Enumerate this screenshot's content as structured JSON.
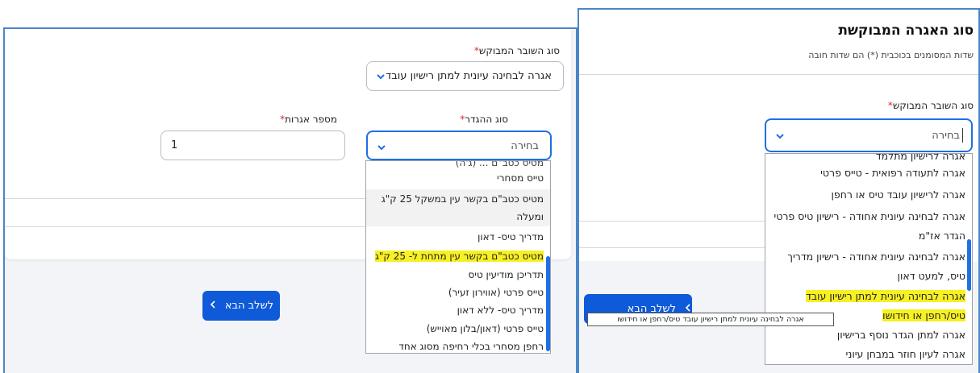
{
  "left": {
    "voucher_label": "סוג השובר המבוקש",
    "voucher_value": "אגרה לבחינה עיונית למתן רישיון עובד",
    "definition_label": "סוג ההגדר",
    "definition_value": "בחירה",
    "count_label": "מספר אגרות",
    "count_value": "1",
    "required_mark": "*",
    "partial_top_option": "מטיס כטב\"ם ... (ג'ה)",
    "options": [
      "טייס מסחרי",
      "מטיס כטב\"ם בקשר עין במשקל 25 ק\"ג ומעלה",
      "מדריך טיס- דאון",
      "מטיס כטב\"ם בקשר עין מתחת ל- 25 ק\"ג",
      "תדריכן מודיעין טיס",
      "טייס פרטי (אווירון זעיר)",
      "מדריך טיס- ללא דאון",
      "טייס פרטי (דאון/בלון מאוייש)",
      "רחפן מסחרי בכלי רחיפה מסוג אחד"
    ],
    "next_button": "לשלב הבא"
  },
  "right": {
    "title": "סוג האגרה המבוקשת",
    "subtitle": "שדות המסומנים בכוכבית (*) הם שדות חובה",
    "voucher_label": "סוג השובר המבוקש",
    "voucher_value": "בחירה",
    "required_mark": "*",
    "partial_top_option": "אגרה לרישיון מתלמד",
    "options": [
      "אגרה לתעודה רפואית - טייס פרטי",
      "אגרה לרישיון עובד טיס או רחפן",
      "אגרה לבחינה עיונית אחודה - רישיון טיס פרטי הגדר אז\"מ",
      "אגרה לבחינה עיונית אחודה - רישיון מדריך טיס, למעט דאון",
      "אגרה לבחינה עיונית למתן רישיון עובד טיס/רחפן או חידושו",
      "אגרה למתן הגדר נוסף ברישיון",
      "אגרה לעיון חוזר במבחן עיוני"
    ],
    "next_button": "לשלב הבא",
    "tooltip": "אגרה לבחינה עיונית למתן רישיון עובד טיס/רחפן או חידושו"
  },
  "colors": {
    "accent": "#1f6fe5",
    "button": "#0f5ad8",
    "highlight": "#f7f022",
    "required": "#e0262f"
  },
  "icons": [
    "chevron-down-icon",
    "chevron-left-icon"
  ]
}
